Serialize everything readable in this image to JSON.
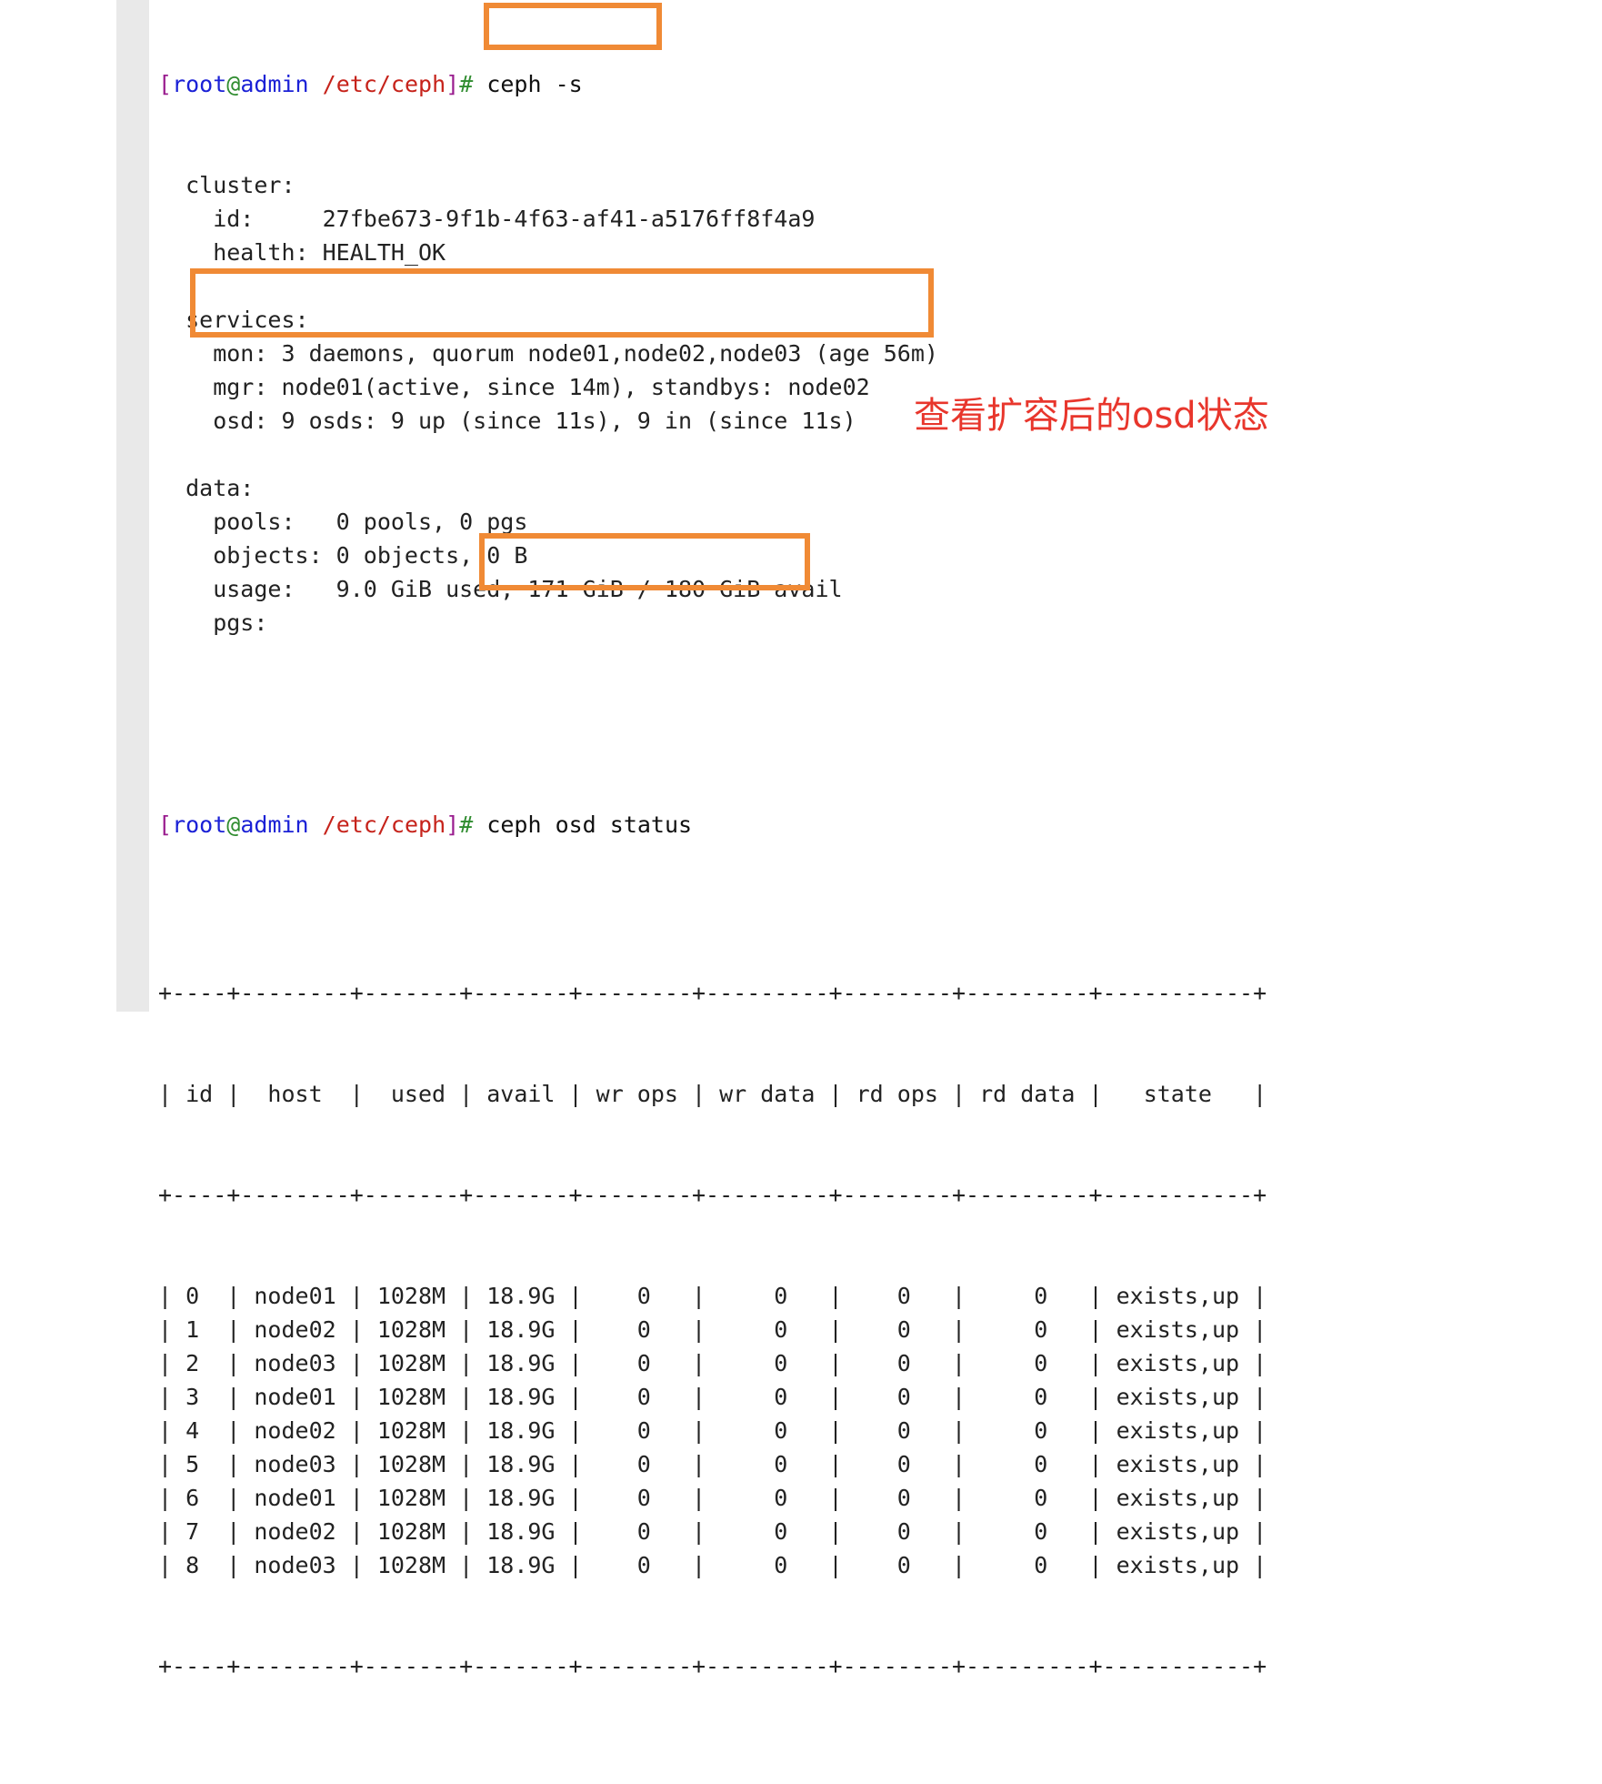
{
  "prompt": {
    "open": "[",
    "user": "root",
    "at": "@",
    "host": "admin",
    "dir": "/etc/ceph",
    "close": "]",
    "hash": "#"
  },
  "commands": {
    "first": " ceph -s",
    "second": " ceph osd status"
  },
  "status_output": [
    "  cluster:",
    "    id:     27fbe673-9f1b-4f63-af41-a5176ff8f4a9",
    "    health: HEALTH_OK",
    "",
    "  services:",
    "    mon: 3 daemons, quorum node01,node02,node03 (age 56m)",
    "    mgr: node01(active, since 14m), standbys: node02",
    "    osd: 9 osds: 9 up (since 11s), 9 in (since 11s)",
    "",
    "  data:",
    "    pools:   0 pools, 0 pgs",
    "    objects: 0 objects, 0 B",
    "    usage:   9.0 GiB used, 171 GiB / 180 GiB avail",
    "    pgs:"
  ],
  "osd_table": {
    "border": "+----+--------+-------+-------+--------+---------+--------+---------+-----------+",
    "header": "| id |  host  |  used | avail | wr ops | wr data | rd ops | rd data |   state   |",
    "rows": [
      "| 0  | node01 | 1028M | 18.9G |    0   |     0   |    0   |     0   | exists,up |",
      "| 1  | node02 | 1028M | 18.9G |    0   |     0   |    0   |     0   | exists,up |",
      "| 2  | node03 | 1028M | 18.9G |    0   |     0   |    0   |     0   | exists,up |",
      "| 3  | node01 | 1028M | 18.9G |    0   |     0   |    0   |     0   | exists,up |",
      "| 4  | node02 | 1028M | 18.9G |    0   |     0   |    0   |     0   | exists,up |",
      "| 5  | node03 | 1028M | 18.9G |    0   |     0   |    0   |     0   | exists,up |",
      "| 6  | node01 | 1028M | 18.9G |    0   |     0   |    0   |     0   | exists,up |",
      "| 7  | node02 | 1028M | 18.9G |    0   |     0   |    0   |     0   | exists,up |",
      "| 8  | node03 | 1028M | 18.9G |    0   |     0   |    0   |     0   | exists,up |"
    ]
  },
  "annotation": "查看扩容后的osd状态",
  "colors": {
    "highlight": "#f08a35",
    "annotation": "#e8362c",
    "prompt_user": "#1b21d6",
    "prompt_dir": "#c6231b"
  }
}
